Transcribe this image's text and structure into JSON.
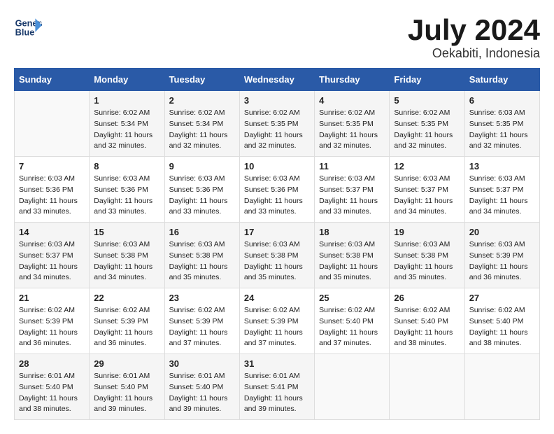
{
  "header": {
    "logo_line1": "General",
    "logo_line2": "Blue",
    "month": "July 2024",
    "location": "Oekabiti, Indonesia"
  },
  "weekdays": [
    "Sunday",
    "Monday",
    "Tuesday",
    "Wednesday",
    "Thursday",
    "Friday",
    "Saturday"
  ],
  "weeks": [
    [
      {
        "day": "",
        "info": ""
      },
      {
        "day": "1",
        "info": "Sunrise: 6:02 AM\nSunset: 5:34 PM\nDaylight: 11 hours\nand 32 minutes."
      },
      {
        "day": "2",
        "info": "Sunrise: 6:02 AM\nSunset: 5:34 PM\nDaylight: 11 hours\nand 32 minutes."
      },
      {
        "day": "3",
        "info": "Sunrise: 6:02 AM\nSunset: 5:35 PM\nDaylight: 11 hours\nand 32 minutes."
      },
      {
        "day": "4",
        "info": "Sunrise: 6:02 AM\nSunset: 5:35 PM\nDaylight: 11 hours\nand 32 minutes."
      },
      {
        "day": "5",
        "info": "Sunrise: 6:02 AM\nSunset: 5:35 PM\nDaylight: 11 hours\nand 32 minutes."
      },
      {
        "day": "6",
        "info": "Sunrise: 6:03 AM\nSunset: 5:35 PM\nDaylight: 11 hours\nand 32 minutes."
      }
    ],
    [
      {
        "day": "7",
        "info": "Sunrise: 6:03 AM\nSunset: 5:36 PM\nDaylight: 11 hours\nand 33 minutes."
      },
      {
        "day": "8",
        "info": "Sunrise: 6:03 AM\nSunset: 5:36 PM\nDaylight: 11 hours\nand 33 minutes."
      },
      {
        "day": "9",
        "info": "Sunrise: 6:03 AM\nSunset: 5:36 PM\nDaylight: 11 hours\nand 33 minutes."
      },
      {
        "day": "10",
        "info": "Sunrise: 6:03 AM\nSunset: 5:36 PM\nDaylight: 11 hours\nand 33 minutes."
      },
      {
        "day": "11",
        "info": "Sunrise: 6:03 AM\nSunset: 5:37 PM\nDaylight: 11 hours\nand 33 minutes."
      },
      {
        "day": "12",
        "info": "Sunrise: 6:03 AM\nSunset: 5:37 PM\nDaylight: 11 hours\nand 34 minutes."
      },
      {
        "day": "13",
        "info": "Sunrise: 6:03 AM\nSunset: 5:37 PM\nDaylight: 11 hours\nand 34 minutes."
      }
    ],
    [
      {
        "day": "14",
        "info": "Sunrise: 6:03 AM\nSunset: 5:37 PM\nDaylight: 11 hours\nand 34 minutes."
      },
      {
        "day": "15",
        "info": "Sunrise: 6:03 AM\nSunset: 5:38 PM\nDaylight: 11 hours\nand 34 minutes."
      },
      {
        "day": "16",
        "info": "Sunrise: 6:03 AM\nSunset: 5:38 PM\nDaylight: 11 hours\nand 35 minutes."
      },
      {
        "day": "17",
        "info": "Sunrise: 6:03 AM\nSunset: 5:38 PM\nDaylight: 11 hours\nand 35 minutes."
      },
      {
        "day": "18",
        "info": "Sunrise: 6:03 AM\nSunset: 5:38 PM\nDaylight: 11 hours\nand 35 minutes."
      },
      {
        "day": "19",
        "info": "Sunrise: 6:03 AM\nSunset: 5:38 PM\nDaylight: 11 hours\nand 35 minutes."
      },
      {
        "day": "20",
        "info": "Sunrise: 6:03 AM\nSunset: 5:39 PM\nDaylight: 11 hours\nand 36 minutes."
      }
    ],
    [
      {
        "day": "21",
        "info": "Sunrise: 6:02 AM\nSunset: 5:39 PM\nDaylight: 11 hours\nand 36 minutes."
      },
      {
        "day": "22",
        "info": "Sunrise: 6:02 AM\nSunset: 5:39 PM\nDaylight: 11 hours\nand 36 minutes."
      },
      {
        "day": "23",
        "info": "Sunrise: 6:02 AM\nSunset: 5:39 PM\nDaylight: 11 hours\nand 37 minutes."
      },
      {
        "day": "24",
        "info": "Sunrise: 6:02 AM\nSunset: 5:39 PM\nDaylight: 11 hours\nand 37 minutes."
      },
      {
        "day": "25",
        "info": "Sunrise: 6:02 AM\nSunset: 5:40 PM\nDaylight: 11 hours\nand 37 minutes."
      },
      {
        "day": "26",
        "info": "Sunrise: 6:02 AM\nSunset: 5:40 PM\nDaylight: 11 hours\nand 38 minutes."
      },
      {
        "day": "27",
        "info": "Sunrise: 6:02 AM\nSunset: 5:40 PM\nDaylight: 11 hours\nand 38 minutes."
      }
    ],
    [
      {
        "day": "28",
        "info": "Sunrise: 6:01 AM\nSunset: 5:40 PM\nDaylight: 11 hours\nand 38 minutes."
      },
      {
        "day": "29",
        "info": "Sunrise: 6:01 AM\nSunset: 5:40 PM\nDaylight: 11 hours\nand 39 minutes."
      },
      {
        "day": "30",
        "info": "Sunrise: 6:01 AM\nSunset: 5:40 PM\nDaylight: 11 hours\nand 39 minutes."
      },
      {
        "day": "31",
        "info": "Sunrise: 6:01 AM\nSunset: 5:41 PM\nDaylight: 11 hours\nand 39 minutes."
      },
      {
        "day": "",
        "info": ""
      },
      {
        "day": "",
        "info": ""
      },
      {
        "day": "",
        "info": ""
      }
    ]
  ]
}
